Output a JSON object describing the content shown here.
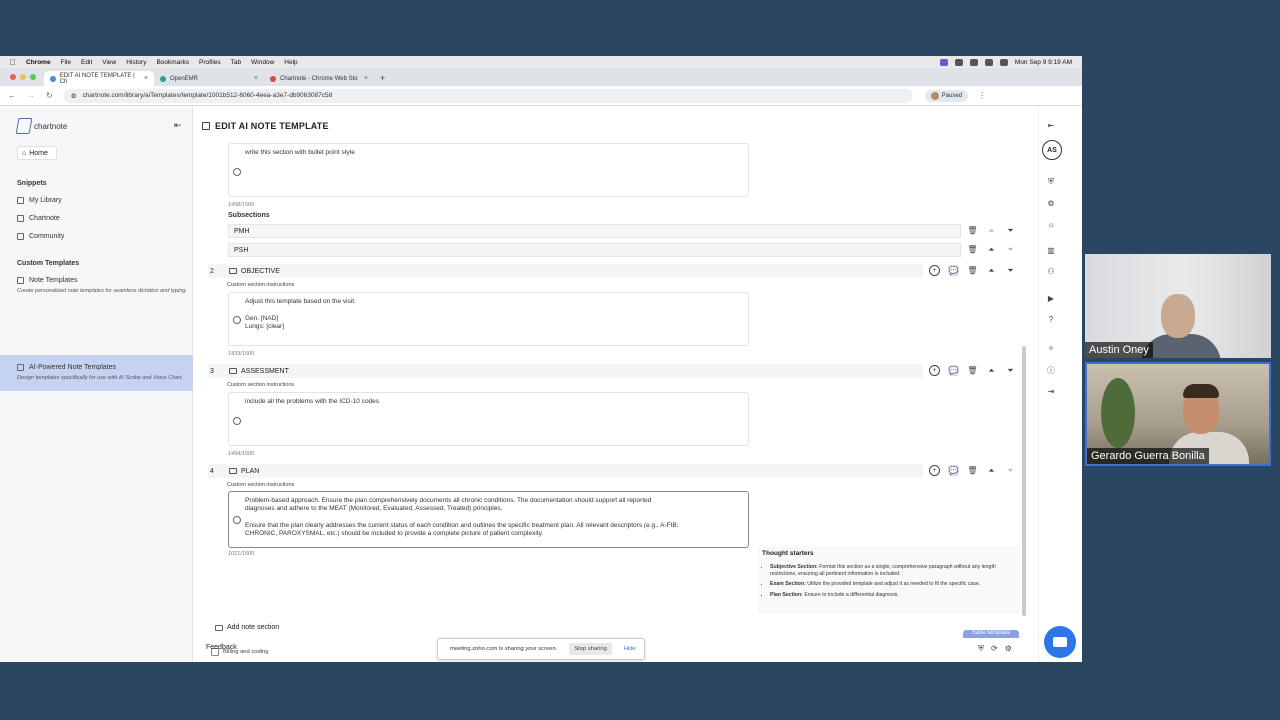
{
  "menubar": {
    "items": [
      "Chrome",
      "File",
      "Edit",
      "View",
      "History",
      "Bookmarks",
      "Profiles",
      "Tab",
      "Window",
      "Help"
    ],
    "datetime": "Mon Sep 9  9:19 AM"
  },
  "tabs": [
    {
      "label": "EDIT AI NOTE TEMPLATE | Ch"
    },
    {
      "label": "OpenEMR"
    },
    {
      "label": "Chartnote - Chrome Web Sto"
    }
  ],
  "address": {
    "url": "chartnote.com/library/aiTemplates/template/1001b512-6060-4eea-a3e7-db9063087c58",
    "profile_status": "Paused"
  },
  "sidebar": {
    "logo": "chartnote",
    "home": "Home",
    "snippets_heading": "Snippets",
    "snippets": [
      "My Library",
      "Chartnote",
      "Community"
    ],
    "custom_heading": "Custom Templates",
    "note_templates": {
      "label": "Note Templates",
      "desc": "Create personalized note templates for seamless dictation and typing."
    },
    "ai_templates": {
      "label": "AI-Powered Note Templates",
      "desc": "Design templates specifically for use with AI Scribe and Voice Chart."
    }
  },
  "page": {
    "title": "EDIT AI NOTE TEMPLATE"
  },
  "section1": {
    "instruction_text": "write this section with bullet point style",
    "count": "1458/1500",
    "subsections_label": "Subsections",
    "subsections": [
      "PMH",
      "PSH"
    ]
  },
  "sections": [
    {
      "num": "2",
      "name": "OBJECTIVE",
      "csi": "Custom section instructions",
      "lines": [
        "Adjust this template based on the visit.",
        "",
        "Gen: [NAD]",
        "Lungs: [clear]"
      ],
      "count": "1433/1500"
    },
    {
      "num": "3",
      "name": "ASSESSMENT",
      "csi": "Custom section instructions",
      "lines": [
        "include all the problems with the ICD-10 codes"
      ],
      "count": "1454/1500"
    },
    {
      "num": "4",
      "name": "PLAN",
      "csi": "Custom section instructions",
      "lines": [
        "Problem-based approach. Ensure the plan comprehensively documents all chronic conditions. The documentation should support all reported",
        "diagnoses and adhere to the MEAT (Monitored, Evaluated, Assessed, Treated) principles.",
        "",
        "Ensure that the plan clearly addresses the current status of each condition and outlines the specific treatment plan. All relevant descriptors (e.g., A-FIB:",
        "CHRONIC, PAROXYSMAL, etc.) should be included to provide a complete picture of patient complexity."
      ],
      "count": "1021/1500"
    }
  ],
  "thought_starters": {
    "title": "Thought starters",
    "items": [
      {
        "label": "Subjective Section:",
        "text": " Format this section as a single, comprehensive paragraph without any length restrictions, ensuring all pertinent information is included."
      },
      {
        "label": "Exam Section:",
        "text": " Utilize the provided template and adjust it as needed to fit the specific case."
      },
      {
        "label": "Plan Section:",
        "text": " Ensure to include a differential diagnosis."
      }
    ]
  },
  "add_section": "Add note section",
  "billing": "Billing and coding",
  "feedback": "Feedback",
  "save": "Save template",
  "share_bar": {
    "text": "meeting.zoho.com is sharing your screen.",
    "stop": "Stop sharing",
    "hide": "Hide"
  },
  "user_initials": "AS",
  "participants": [
    "Austin Oney",
    "Gerardo Guerra Bonilla"
  ],
  "colors": {
    "background": "#2b4660",
    "accent": "#c6d2f1",
    "chat": "#2d76e8"
  }
}
